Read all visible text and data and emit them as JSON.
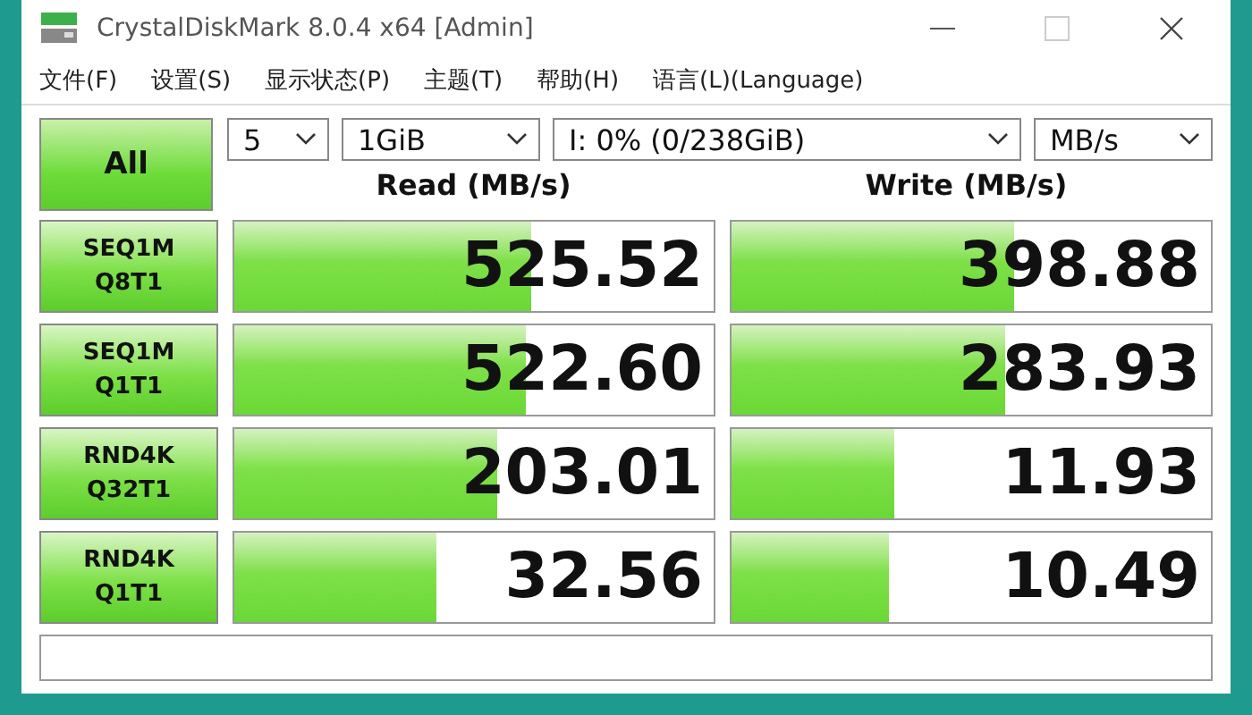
{
  "window": {
    "title": "CrystalDiskMark 8.0.4 x64 [Admin]"
  },
  "menu": [
    "文件(F)",
    "设置(S)",
    "显示状态(P)",
    "主题(T)",
    "帮助(H)",
    "语言(L)(Language)"
  ],
  "all_button": "All",
  "selectors": [
    {
      "value": "5",
      "kind": "count"
    },
    {
      "value": "1GiB",
      "kind": "size"
    },
    {
      "value": "I: 0% (0/238GiB)",
      "kind": "drive"
    },
    {
      "value": "MB/s",
      "kind": "unit"
    }
  ],
  "headers": [
    "Read (MB/s)",
    "Write (MB/s)"
  ],
  "tests": [
    {
      "line1": "SEQ1M",
      "line2": "Q8T1",
      "read": {
        "value": "525.52",
        "level": 0.62
      },
      "write": {
        "value": "398.88",
        "level": 0.59
      }
    },
    {
      "line1": "SEQ1M",
      "line2": "Q1T1",
      "read": {
        "value": "522.60",
        "level": 0.61
      },
      "write": {
        "value": "283.93",
        "level": 0.57
      }
    },
    {
      "line1": "RND4K",
      "line2": "Q32T1",
      "read": {
        "value": "203.01",
        "level": 0.55
      },
      "write": {
        "value": "11.93",
        "level": 0.34
      }
    },
    {
      "line1": "RND4K",
      "line2": "Q1T1",
      "read": {
        "value": "32.56",
        "level": 0.42
      },
      "write": {
        "value": "10.49",
        "level": 0.33
      }
    }
  ]
}
